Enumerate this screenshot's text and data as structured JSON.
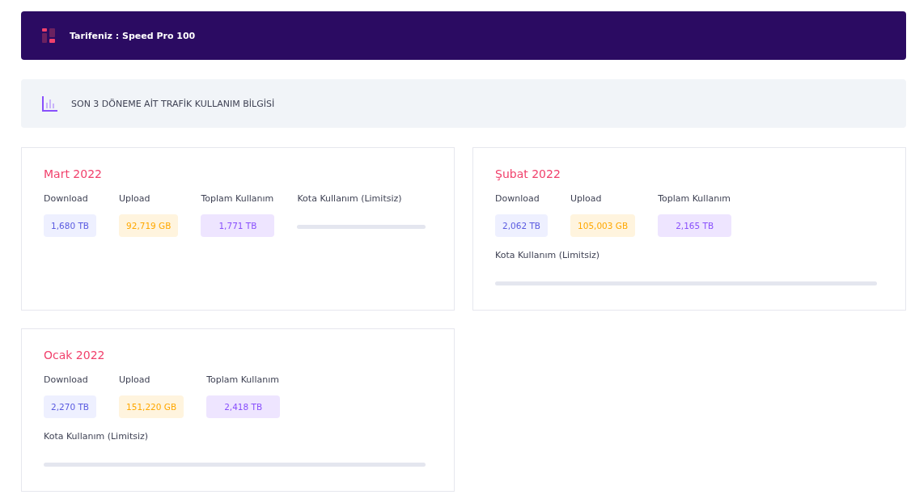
{
  "tariff": {
    "title": "Tarifeniz : Speed Pro 100"
  },
  "section": {
    "title": "SON 3 DÖNEME AİT TRAFİK KULLANIM BİLGİSİ"
  },
  "periods": [
    {
      "title": "Mart 2022",
      "stats": [
        {
          "kind": "download",
          "label": "Download",
          "value": "1,680 TB"
        },
        {
          "kind": "upload",
          "label": "Upload",
          "value": "92,719 GB"
        },
        {
          "kind": "total",
          "label": "Toplam Kullanım",
          "value": "1,771 TB"
        }
      ],
      "quota": {
        "label": "Kota Kullanım (Limitsiz)",
        "level": 0
      }
    },
    {
      "title": "Şubat 2022",
      "stats": [
        {
          "kind": "download",
          "label": "Download",
          "value": "2,062 TB"
        },
        {
          "kind": "upload",
          "label": "Upload",
          "value": "105,003 GB"
        },
        {
          "kind": "total",
          "label": "Toplam Kullanım",
          "value": "2,165 TB"
        }
      ],
      "quota": {
        "label": "Kota Kullanım (Limitsiz)",
        "level": 0
      }
    },
    {
      "title": "Ocak 2022",
      "stats": [
        {
          "kind": "download",
          "label": "Download",
          "value": "2,270 TB"
        },
        {
          "kind": "upload",
          "label": "Upload",
          "value": "151,220 GB"
        },
        {
          "kind": "total",
          "label": "Toplam Kullanım",
          "value": "2,418 TB"
        }
      ],
      "quota": {
        "label": "Kota Kullanım (Limitsiz)",
        "level": 0
      }
    }
  ]
}
